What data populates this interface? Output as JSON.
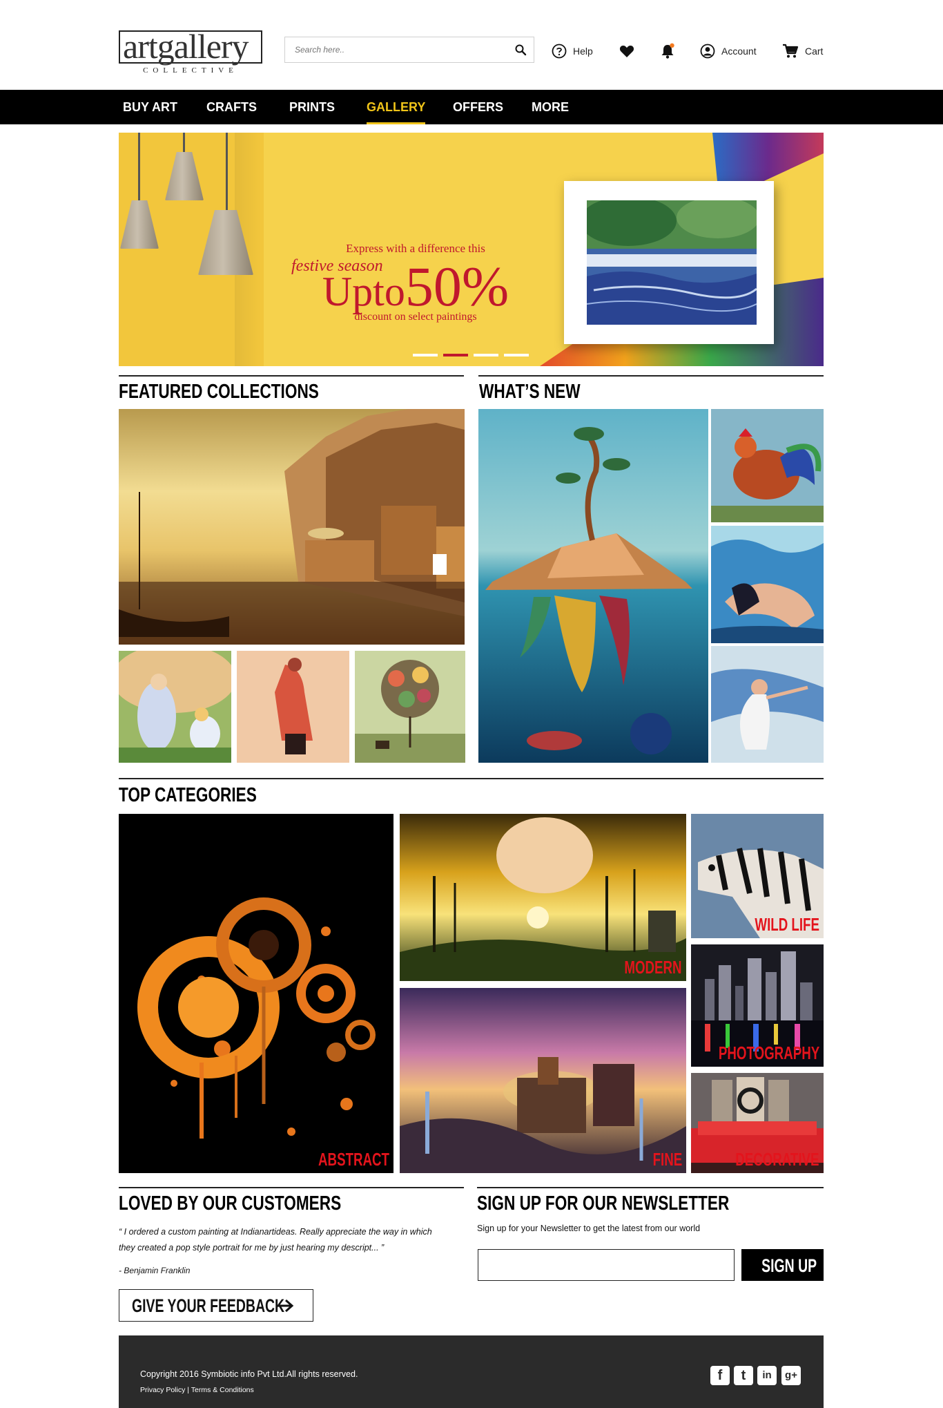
{
  "brand": {
    "logo_main": "artgallery",
    "logo_sub": "COLLECTIVE"
  },
  "search": {
    "placeholder": "Search here.."
  },
  "header_nav": {
    "help": "Help",
    "account": "Account",
    "cart": "Cart"
  },
  "main_nav": [
    "BUY ART",
    "CRAFTS",
    "PRINTS",
    "GALLERY",
    "OFFERS",
    "MORE"
  ],
  "active_nav": "GALLERY",
  "hero": {
    "line1": "Express with a difference this",
    "line2": "festive season",
    "line3_a": "Upto",
    "line3_b": "50%",
    "line4": "discount on select paintings",
    "active_slide": 2,
    "slide_count": 4
  },
  "sections": {
    "featured": "FEATURED COLLECTIONS",
    "whats_new": "WHAT’S NEW",
    "top_categories": "TOP CATEGORIES",
    "loved": "LOVED BY OUR CUSTOMERS",
    "newsletter": "SIGN UP FOR OUR NEWSLETTER"
  },
  "categories": {
    "abstract": "ABSTRACT",
    "modern": "MODERN",
    "fine": "FINE",
    "wildlife": "WILD LIFE",
    "photography": "PHOTOGRAPHY",
    "decorative": "DECORATIVE"
  },
  "testimonial": {
    "quote_line1": "“ I ordered a custom painting at Indianartideas. Really appreciate the way in which",
    "quote_line2": "they created a pop style portrait for me by just hearing my descript... ”",
    "author": "- Benjamin Franklin",
    "feedback_button": "GIVE YOUR FEEDBACK"
  },
  "newsletter": {
    "text": "Sign up for your Newsletter to get the latest from our world",
    "input_value": "",
    "button": "SIGN UP"
  },
  "footer": {
    "copyright": "Copyright 2016 Symbiotic info Pvt Ltd.All rights reserved.",
    "privacy": "Privacy Policy",
    "separator": " | ",
    "terms": "Terms & Conditions",
    "social": [
      "f",
      "t",
      "in",
      "g+"
    ]
  },
  "colors": {
    "accent": "#f0c419",
    "brand_red": "#e3141c",
    "hero_text": "#c0182d",
    "nav_bg": "#000000",
    "footer_bg": "#2b2b2b",
    "hero_bg": "#f6d24c"
  },
  "icons": {
    "search": "magnifier-icon",
    "help": "question-circle-icon",
    "wishlist": "heart-icon",
    "notifications": "bell-icon",
    "account": "user-circle-icon",
    "cart": "shopping-cart-icon",
    "feedback_arrow": "arrow-right-icon"
  }
}
